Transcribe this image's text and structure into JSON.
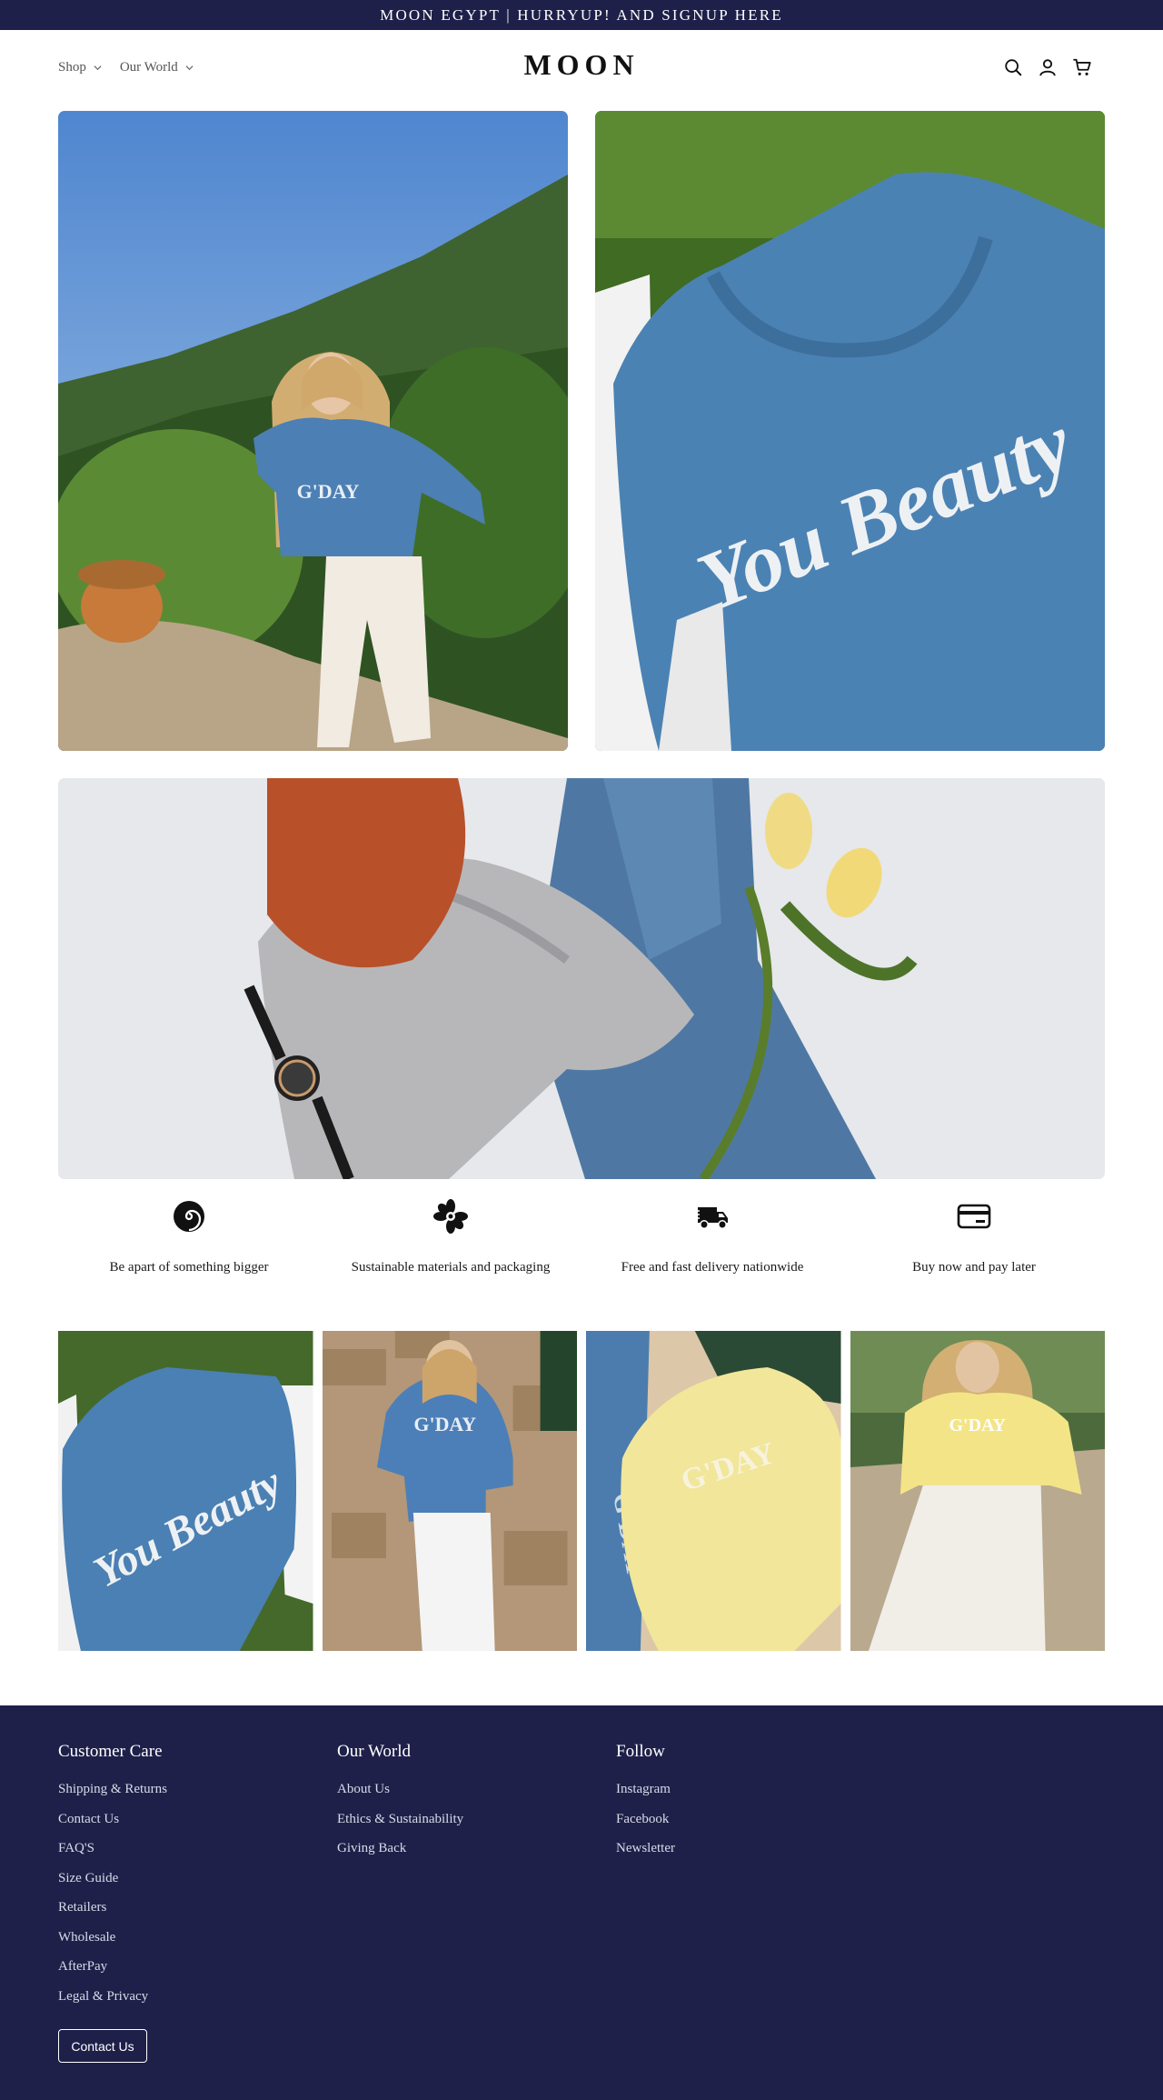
{
  "announcement": "MOON EGYPT | HURRYUP! AND SIGNUP HERE",
  "nav": {
    "items": [
      {
        "label": "Shop",
        "icon": "chevron-down-icon"
      },
      {
        "label": "Our World",
        "icon": "chevron-down-icon"
      }
    ]
  },
  "brand": {
    "logo": "MOON"
  },
  "header_icons": [
    "search-icon",
    "account-icon",
    "cart-icon"
  ],
  "hero": {
    "images": [
      {
        "name": "hero-image-gday-sweater-woman",
        "sweater_text": "G'DAY"
      },
      {
        "name": "hero-image-you-beauty-sweater",
        "sweater_text": "You Beauty"
      }
    ],
    "banner": {
      "name": "banner-flatlay-knitwear"
    }
  },
  "features": [
    {
      "icon": "spiral-icon",
      "label": "Be apart of something bigger"
    },
    {
      "icon": "flower-icon",
      "label": "Sustainable materials and packaging"
    },
    {
      "icon": "delivery-truck-icon",
      "label": "Free and fast delivery nationwide"
    },
    {
      "icon": "credit-card-icon",
      "label": "Buy now and pay later"
    }
  ],
  "gallery": [
    {
      "name": "gallery-you-beauty-blue",
      "text": "You Beauty"
    },
    {
      "name": "gallery-gday-blue-wall",
      "text": "G'DAY"
    },
    {
      "name": "gallery-yellow-flatlay",
      "text": "G'DAY"
    },
    {
      "name": "gallery-gday-yellow-woman",
      "text": "G'DAY"
    }
  ],
  "footer": {
    "customer_care": {
      "title": "Customer Care",
      "links": [
        "Shipping & Returns",
        "Contact Us",
        "FAQ'S",
        "Size Guide",
        "Retailers",
        "Wholesale",
        "AfterPay",
        "Legal & Privacy"
      ]
    },
    "our_world": {
      "title": "Our World",
      "links": [
        "About Us",
        "Ethics & Sustainability",
        "Giving Back"
      ]
    },
    "follow": {
      "title": "Follow",
      "links": [
        "Instagram",
        "Facebook",
        "Newsletter"
      ]
    },
    "contact_button": "Contact Us"
  },
  "colors": {
    "navy": "#1e2049",
    "sweater_blue": "#4b82b4",
    "sweater_yellow": "#f1e69a",
    "white": "#ffffff"
  }
}
